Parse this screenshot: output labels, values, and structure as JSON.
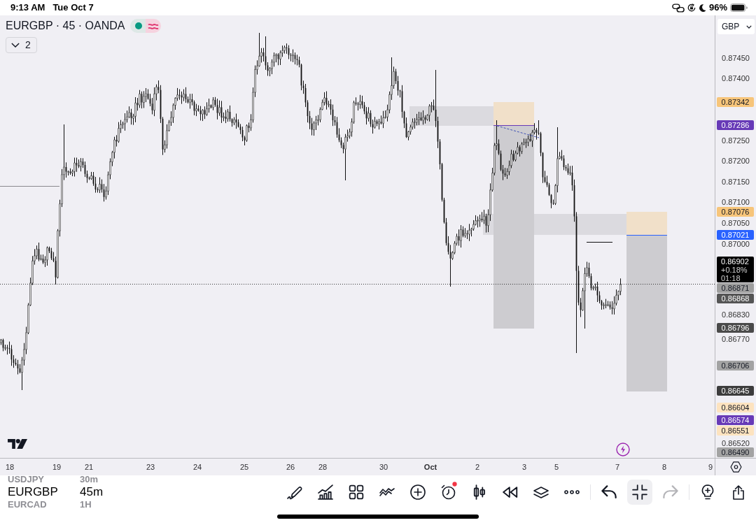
{
  "status_bar": {
    "time": "9:13 AM",
    "date": "Tue Oct 7",
    "battery": "96%"
  },
  "chart": {
    "title": "EURGBP · 45 · OANDA",
    "indicators_count": "2",
    "currency": "GBP",
    "price_scale": [
      {
        "kind": "grid",
        "text": "0.87450"
      },
      {
        "kind": "grid",
        "text": "0.87400"
      },
      {
        "kind": "marker",
        "text": "0.87342",
        "color": "#f7c57a"
      },
      {
        "kind": "marker",
        "text": "0.87286",
        "color": "#673ab7"
      },
      {
        "kind": "grid",
        "text": "0.87250"
      },
      {
        "kind": "grid",
        "text": "0.87200"
      },
      {
        "kind": "grid",
        "text": "0.87150"
      },
      {
        "kind": "grid",
        "text": "0.87100"
      },
      {
        "kind": "marker",
        "text": "0.87076",
        "color": "#f7c57a"
      },
      {
        "kind": "grid",
        "text": "0.87050"
      },
      {
        "kind": "marker",
        "text": "0.87021",
        "color": "#2962ff"
      },
      {
        "kind": "grid",
        "text": "0.87000"
      },
      {
        "kind": "last",
        "lines": [
          "0.86902",
          "+0.18%",
          "01:18"
        ],
        "color": "#000000"
      },
      {
        "kind": "marker",
        "text": "0.86871",
        "color": "#9e9e9e"
      },
      {
        "kind": "marker",
        "text": "0.86868",
        "color": "#555555"
      },
      {
        "kind": "grid",
        "text": "0.86830"
      },
      {
        "kind": "marker",
        "text": "0.86796",
        "color": "#4a4a4a"
      },
      {
        "kind": "grid",
        "text": "0.86770"
      },
      {
        "kind": "marker",
        "text": "0.86706",
        "color": "#a3a3a3"
      },
      {
        "kind": "marker",
        "text": "0.86645",
        "color": "#3c3c3c"
      },
      {
        "kind": "marker",
        "text": "0.86604",
        "color": "#fde3bf"
      },
      {
        "kind": "marker",
        "text": "0.86574",
        "color": "#673ab7"
      },
      {
        "kind": "marker",
        "text": "0.86551",
        "color": "#fde3bf"
      },
      {
        "kind": "grid",
        "text": "0.86520"
      },
      {
        "kind": "marker",
        "text": "0.86490",
        "color": "#a3a3a3"
      }
    ],
    "time_scale": [
      {
        "kind": "day",
        "text": "18"
      },
      {
        "kind": "day",
        "text": "19"
      },
      {
        "kind": "day",
        "text": "21"
      },
      {
        "kind": "day",
        "text": "23"
      },
      {
        "kind": "day",
        "text": "24"
      },
      {
        "kind": "day",
        "text": "25"
      },
      {
        "kind": "day",
        "text": "26"
      },
      {
        "kind": "day",
        "text": "28"
      },
      {
        "kind": "day",
        "text": "30"
      },
      {
        "kind": "month",
        "text": "Oct"
      },
      {
        "kind": "day",
        "text": "2"
      },
      {
        "kind": "day",
        "text": "3"
      },
      {
        "kind": "day",
        "text": "5"
      },
      {
        "kind": "day",
        "text": "7"
      },
      {
        "kind": "day",
        "text": "8"
      },
      {
        "kind": "day",
        "text": "9"
      }
    ]
  },
  "symbol_picker": [
    {
      "label": "USDJPY",
      "selected": false
    },
    {
      "label": "EURGBP",
      "selected": true
    },
    {
      "label": "EURCAD",
      "selected": false
    }
  ],
  "interval_picker": [
    {
      "label": "30m",
      "selected": false
    },
    {
      "label": "45m",
      "selected": true
    },
    {
      "label": "1H",
      "selected": false
    }
  ],
  "toolbar": [
    {
      "kind": "pen",
      "selected": false,
      "disabled": false,
      "notification": false
    },
    {
      "kind": "bars",
      "selected": false,
      "disabled": false,
      "notification": false
    },
    {
      "kind": "grid",
      "selected": false,
      "disabled": false,
      "notification": false
    },
    {
      "kind": "wave",
      "selected": false,
      "disabled": false,
      "notification": false
    },
    {
      "kind": "plus",
      "selected": false,
      "disabled": false,
      "notification": false
    },
    {
      "kind": "alarm",
      "selected": false,
      "disabled": false,
      "notification": true
    },
    {
      "kind": "candles",
      "selected": false,
      "disabled": false,
      "notification": false
    },
    {
      "kind": "rewind",
      "selected": false,
      "disabled": false,
      "notification": false
    },
    {
      "kind": "layers",
      "selected": false,
      "disabled": false,
      "notification": false
    },
    {
      "kind": "more",
      "selected": false,
      "disabled": false,
      "notification": false
    },
    {
      "kind": "separator"
    },
    {
      "kind": "undo",
      "selected": false,
      "disabled": false,
      "notification": false
    },
    {
      "kind": "collapse",
      "selected": true,
      "disabled": false,
      "notification": false
    },
    {
      "kind": "redo",
      "selected": false,
      "disabled": true,
      "notification": false
    },
    {
      "kind": "separator"
    },
    {
      "kind": "bulb",
      "selected": false,
      "disabled": false,
      "notification": false
    },
    {
      "kind": "share",
      "selected": false,
      "disabled": false,
      "notification": false
    }
  ]
}
